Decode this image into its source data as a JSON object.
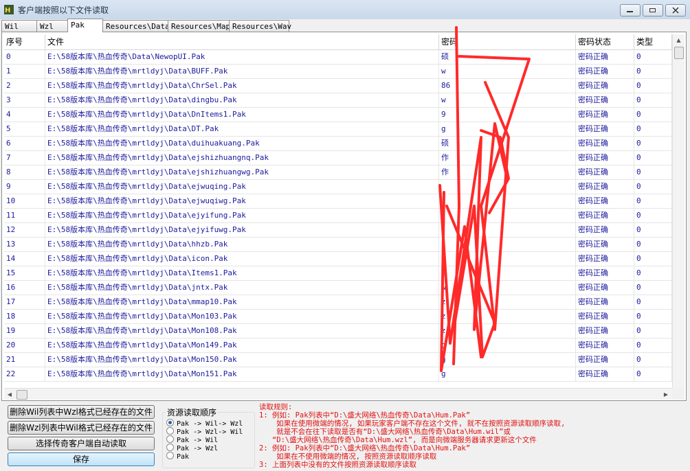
{
  "window": {
    "title": "客户端按照以下文件读取"
  },
  "tabs": [
    "Wil",
    "Wzl",
    "Pak",
    "Resources\\Data",
    "Resources\\Map",
    "Resources\\Wav"
  ],
  "active_tab": "Pak",
  "columns": [
    "序号",
    "文件",
    "密码",
    "密码状态",
    "类型"
  ],
  "rows": [
    {
      "index": "0",
      "file": "E:\\58版本库\\热血传奇\\Data\\NewopUI.Pak",
      "password": "硕",
      "status": "密码正确",
      "type": "0"
    },
    {
      "index": "1",
      "file": "E:\\58版本库\\热血传奇\\mrtldyj\\Data\\BUFF.Pak",
      "password": "w",
      "status": "密码正确",
      "type": "0"
    },
    {
      "index": "2",
      "file": "E:\\58版本库\\热血传奇\\mrtldyj\\Data\\ChrSel.Pak",
      "password": "86",
      "status": "密码正确",
      "type": "0"
    },
    {
      "index": "3",
      "file": "E:\\58版本库\\热血传奇\\mrtldyj\\Data\\dingbu.Pak",
      "password": "w",
      "status": "密码正确",
      "type": "0"
    },
    {
      "index": "4",
      "file": "E:\\58版本库\\热血传奇\\mrtldyj\\Data\\DnItems1.Pak",
      "password": "9",
      "status": "密码正确",
      "type": "0"
    },
    {
      "index": "5",
      "file": "E:\\58版本库\\热血传奇\\mrtldyj\\Data\\DT.Pak",
      "password": "g",
      "status": "密码正确",
      "type": "0"
    },
    {
      "index": "6",
      "file": "E:\\58版本库\\热血传奇\\mrtldyj\\Data\\duihuakuang.Pak",
      "password": "硕",
      "status": "密码正确",
      "type": "0"
    },
    {
      "index": "7",
      "file": "E:\\58版本库\\热血传奇\\mrtldyj\\Data\\ejshizhuangnq.Pak",
      "password": "作",
      "status": "密码正确",
      "type": "0"
    },
    {
      "index": "8",
      "file": "E:\\58版本库\\热血传奇\\mrtldyj\\Data\\ejshizhuangwg.Pak",
      "password": "作",
      "status": "密码正确",
      "type": "0"
    },
    {
      "index": "9",
      "file": "E:\\58版本库\\热血传奇\\mrtldyj\\Data\\ejwuqing.Pak",
      "password": "",
      "status": "密码正确",
      "type": "0"
    },
    {
      "index": "10",
      "file": "E:\\58版本库\\热血传奇\\mrtldyj\\Data\\ejwuqiwg.Pak",
      "password": "",
      "status": "密码正确",
      "type": "0"
    },
    {
      "index": "11",
      "file": "E:\\58版本库\\热血传奇\\mrtldyj\\Data\\ejyifung.Pak",
      "password": "",
      "status": "密码正确",
      "type": "0"
    },
    {
      "index": "12",
      "file": "E:\\58版本库\\热血传奇\\mrtldyj\\Data\\ejyifuwg.Pak",
      "password": "",
      "status": "密码正确",
      "type": "0"
    },
    {
      "index": "13",
      "file": "E:\\58版本库\\热血传奇\\mrtldyj\\Data\\hhzb.Pak",
      "password": "",
      "status": "密码正确",
      "type": "0"
    },
    {
      "index": "14",
      "file": "E:\\58版本库\\热血传奇\\mrtldyj\\Data\\icon.Pak",
      "password": "",
      "status": "密码正确",
      "type": "0"
    },
    {
      "index": "15",
      "file": "E:\\58版本库\\热血传奇\\mrtldyj\\Data\\Items1.Pak",
      "password": "9",
      "status": "密码正确",
      "type": "0"
    },
    {
      "index": "16",
      "file": "E:\\58版本库\\热血传奇\\mrtldyj\\Data\\jntx.Pak",
      "password": "w",
      "status": "密码正确",
      "type": "0"
    },
    {
      "index": "17",
      "file": "E:\\58版本库\\热血传奇\\mrtldyj\\Data\\mmap10.Pak",
      "password": "z",
      "status": "密码正确",
      "type": "0"
    },
    {
      "index": "18",
      "file": "E:\\58版本库\\热血传奇\\mrtldyj\\Data\\Mon103.Pak",
      "password": "z",
      "status": "密码正确",
      "type": "0"
    },
    {
      "index": "19",
      "file": "E:\\58版本库\\热血传奇\\mrtldyj\\Data\\Mon108.Pak",
      "password": "z",
      "status": "密码正确",
      "type": "0"
    },
    {
      "index": "20",
      "file": "E:\\58版本库\\热血传奇\\mrtldyj\\Data\\Mon149.Pak",
      "password": "g",
      "status": "密码正确",
      "type": "0"
    },
    {
      "index": "21",
      "file": "E:\\58版本库\\热血传奇\\mrtldyj\\Data\\Mon150.Pak",
      "password": "g",
      "status": "密码正确",
      "type": "0"
    },
    {
      "index": "22",
      "file": "E:\\58版本库\\热血传奇\\mrtldyj\\Data\\Mon151.Pak",
      "password": "g",
      "status": "密码正确",
      "type": "0"
    }
  ],
  "buttons": {
    "delete_wil": "删除Wil列表中Wzl格式已经存在的文件",
    "delete_wzl": "删除Wzl列表中Wil格式已经存在的文件",
    "auto_read": "选择传奇客户端自动读取",
    "save": "保存"
  },
  "read_order": {
    "title": "资源读取顺序",
    "options": [
      "Pak -> Wil-> Wzl",
      "Pak -> Wzl-> Wil",
      "Pak -> Wil",
      "Pak -> Wzl",
      "Pak"
    ],
    "selected": 0
  },
  "rules_text": "读取规则:\n1: 例如: Pak列表中“D:\\盛大网络\\热血传奇\\Data\\Hum.Pak”\n    如果在使用微端的情况, 如果玩家客户端不存在这个文件, 就不在按照资源读取顺序读取,\n    就是不会在往下读取是否有“D:\\盛大网络\\热血传奇\\Data\\Hum.wil”或\n   “D:\\盛大网络\\热血传奇\\Data\\Hum.wzl”, 而是向微端服务器请求更新这个文件\n2: 例如: Pak列表中“D:\\盛大网络\\热血传奇\\Data\\Hum.Pak”\n    如果在不使用微端的情况, 按照资源读取顺序读取\n3: 上面列表中没有的文件按照资源读取顺序读取",
  "colors": {
    "list_text": "#1a1a9c",
    "rules_text": "#e01010",
    "scribble": "#ff2a2a"
  }
}
